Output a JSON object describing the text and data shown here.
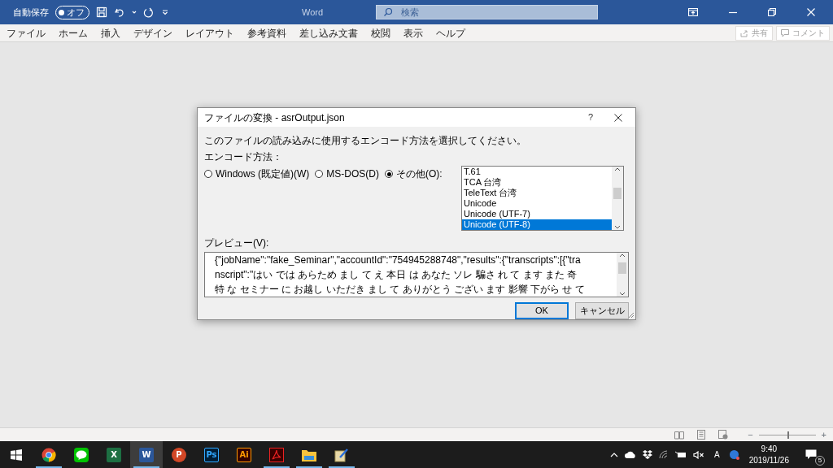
{
  "titlebar": {
    "autosave_label": "自動保存",
    "autosave_toggle": {
      "text": "オフ",
      "on": false
    },
    "app_title": "Word",
    "search": {
      "placeholder": "検索"
    }
  },
  "ribbon_tabs": [
    {
      "label": "ファイル"
    },
    {
      "label": "ホーム"
    },
    {
      "label": "挿入"
    },
    {
      "label": "デザイン"
    },
    {
      "label": "レイアウト"
    },
    {
      "label": "参考資料"
    },
    {
      "label": "差し込み文書"
    },
    {
      "label": "校閲"
    },
    {
      "label": "表示"
    },
    {
      "label": "ヘルプ"
    }
  ],
  "ribbon_buttons": [
    {
      "label": "共有",
      "kind": "share"
    },
    {
      "label": "コメント",
      "kind": "comment"
    }
  ],
  "dialog": {
    "title": "ファイルの変換 - asrOutput.json",
    "help": "?",
    "instruction": "このファイルの読み込みに使用するエンコード方法を選択してください。",
    "encoding_label": "エンコード方法：",
    "radios": [
      {
        "label": "Windows (既定値)(W)",
        "selected": false
      },
      {
        "label": "MS-DOS(D)",
        "selected": false
      },
      {
        "label": "その他(O):",
        "selected": true
      }
    ],
    "encodings": [
      {
        "label": "T.61",
        "selected": false
      },
      {
        "label": "TCA 台湾",
        "selected": false
      },
      {
        "label": "TeleText 台湾",
        "selected": false
      },
      {
        "label": "Unicode",
        "selected": false
      },
      {
        "label": "Unicode (UTF-7)",
        "selected": false
      },
      {
        "label": "Unicode (UTF-8)",
        "selected": true
      }
    ],
    "preview_label": "プレビュー(V):",
    "preview_lines": [
      "{\"jobName\":\"fake_Seminar\",\"accountId\":\"754945288748\",\"results\":{\"transcripts\":[{\"tra",
      "nscript\":\"はい では あらため まし て え 本日 は あなた ソレ 騙さ れ て ます また 奇",
      "特 な セミナー に お越し いただき まし て ありがとう ござい ます 影響 下がら せ て"
    ],
    "buttons": [
      {
        "label": "OK",
        "default": true
      },
      {
        "label": "キャンセル",
        "default": false
      }
    ]
  },
  "status_bar": {
    "zoom_minus": "−",
    "zoom_plus": "+",
    "zoom": {
      "level": 0.5
    }
  },
  "taskbar": {
    "apps": [
      {
        "kind": "start",
        "running": false,
        "selected": false
      },
      {
        "kind": "chrome",
        "running": true,
        "selected": false
      },
      {
        "kind": "line",
        "running": false,
        "selected": false
      },
      {
        "kind": "excel",
        "label": "X",
        "running": false,
        "selected": false
      },
      {
        "kind": "word",
        "label": "W",
        "running": true,
        "selected": true
      },
      {
        "kind": "powerpoint",
        "label": "P",
        "running": false,
        "selected": false
      },
      {
        "kind": "photoshop",
        "label": "Ps",
        "running": false,
        "selected": false
      },
      {
        "kind": "illustrator",
        "label": "Ai",
        "running": false,
        "selected": false
      },
      {
        "kind": "acrobat",
        "running": true,
        "selected": false
      },
      {
        "kind": "explorer",
        "running": true,
        "selected": false
      },
      {
        "kind": "notes",
        "running": true,
        "selected": false
      }
    ],
    "ime": "A",
    "time": "9:40",
    "date": "2019/11/26",
    "notifications": "5"
  }
}
